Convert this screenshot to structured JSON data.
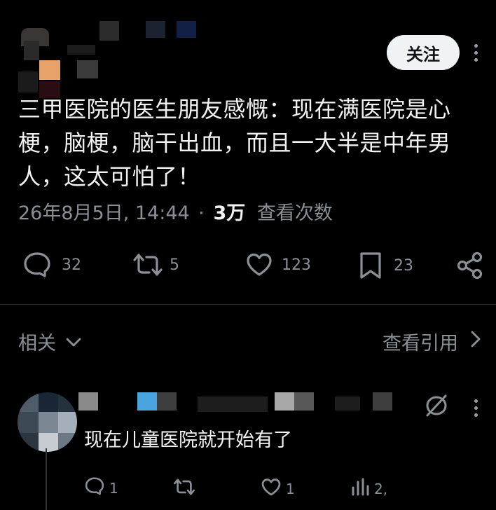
{
  "header": {
    "follow_label": "关注"
  },
  "tweet": {
    "text": "三甲医院的医生朋友感慨：现在满医院是心梗，脑梗，脑干出血，而且一大半是中年男人，这太可怕了！",
    "timestamp": "26年8月5日, 14:44",
    "separator": "·",
    "views_count": "3万",
    "views_label": "查看次数",
    "replies": "32",
    "retweets": "5",
    "likes": "123",
    "bookmarks": "23"
  },
  "section": {
    "related_label": "相关",
    "view_quotes_label": "查看引用"
  },
  "reply": {
    "text": "现在儿童医院就开始有了",
    "replies": "1",
    "likes": "1",
    "views": "2,"
  },
  "colors": {
    "background": "#000000",
    "text_primary": "#e7e9ea",
    "text_secondary": "#8b9096",
    "follow_button_bg": "#eff3f4",
    "divider": "#2f3336"
  },
  "icons": {
    "reply": "speech-bubble-icon",
    "retweet": "retweet-icon",
    "like": "heart-icon",
    "bookmark": "bookmark-icon",
    "share": "share-icon",
    "more": "more-vertical-icon",
    "chevron_down": "chevron-down-icon",
    "chevron_right": "chevron-right-icon",
    "hidden": "eye-slash-icon",
    "views": "bar-chart-icon"
  }
}
